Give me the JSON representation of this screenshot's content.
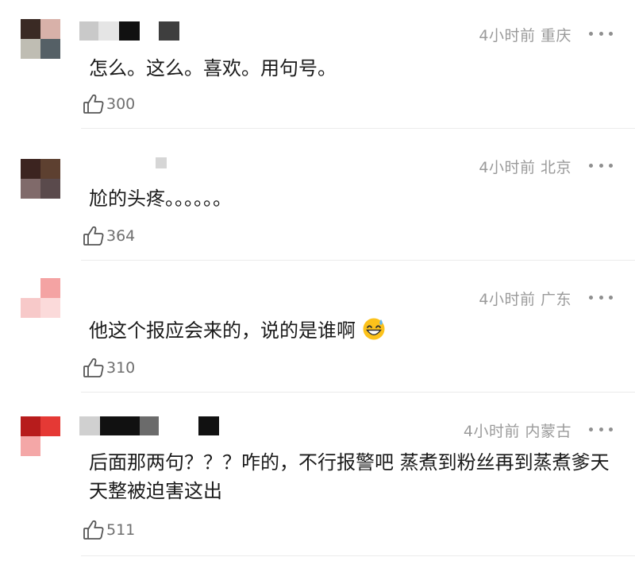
{
  "comments": [
    {
      "meta": "4小时前 重庆",
      "text": "怎么。这么。喜欢。用句号。",
      "likes": "300"
    },
    {
      "meta": "4小时前 北京",
      "text": "尬的头疼。。。。。。",
      "likes": "364"
    },
    {
      "meta": "4小时前 广东",
      "text": "他这个报应会来的，说的是谁啊",
      "likes": "310",
      "emoji": "grinning-sweat-emoji"
    },
    {
      "meta": "4小时前 内蒙古",
      "text": "后面那两句？？？咋的，不行报警吧 蒸煮到粉丝再到蒸煮爹天天整被迫害这出",
      "likes": "511"
    }
  ],
  "icons": {
    "like": "thumbs-up-icon",
    "more": "more-dots-icon"
  },
  "colors": {
    "meta": "#9a9a9a",
    "text": "#1a1a1a",
    "divider": "#ebebeb"
  }
}
